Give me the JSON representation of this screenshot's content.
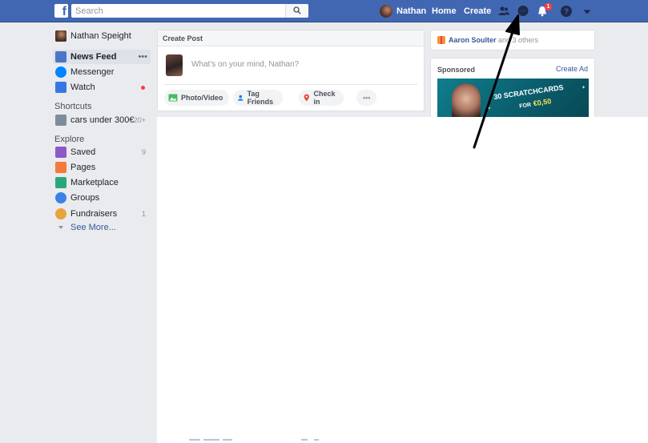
{
  "topbar": {
    "logo": "f",
    "search_placeholder": "Search",
    "profile_name": "Nathan",
    "home_label": "Home",
    "create_label": "Create",
    "notification_count": "1",
    "icons": [
      "friends-icon",
      "messenger-icon",
      "notifications-icon",
      "help-icon",
      "caret-down-icon"
    ]
  },
  "leftnav": {
    "profile_name": "Nathan Speight",
    "items": [
      {
        "label": "News Feed",
        "icon": "news-feed-icon",
        "more": "•••"
      },
      {
        "label": "Messenger",
        "icon": "messenger-icon"
      },
      {
        "label": "Watch",
        "icon": "watch-icon"
      }
    ],
    "shortcuts_heading": "Shortcuts",
    "shortcuts": [
      {
        "label": "cars under 300€",
        "count": "20+"
      }
    ],
    "explore_heading": "Explore",
    "explore": [
      {
        "label": "Saved",
        "count": "9",
        "icon": "saved-icon"
      },
      {
        "label": "Pages",
        "count": "",
        "icon": "pages-icon"
      },
      {
        "label": "Marketplace",
        "count": "",
        "icon": "marketplace-icon"
      },
      {
        "label": "Groups",
        "count": "",
        "icon": "groups-icon"
      },
      {
        "label": "Fundraisers",
        "count": "1",
        "icon": "fundraisers-icon"
      }
    ],
    "see_more": "See More..."
  },
  "create_post": {
    "title": "Create Post",
    "placeholder": "What's on your mind, Nathan?",
    "actions": [
      "Photo/Video",
      "Tag Friends",
      "Check in",
      "•••"
    ]
  },
  "birthday": {
    "name": "Aaron Soulter",
    "suffix": " and 3 others"
  },
  "sponsored": {
    "title": "Sponsored",
    "create_ad": "Create Ad",
    "ad_line1": "30 SCRATCHCARDS",
    "ad_for": "FOR",
    "ad_line2": "€0,50"
  },
  "colors": {
    "brand": "#4267b2",
    "background": "#e9ebee",
    "link": "#365899",
    "notification": "#fa3e3e"
  }
}
